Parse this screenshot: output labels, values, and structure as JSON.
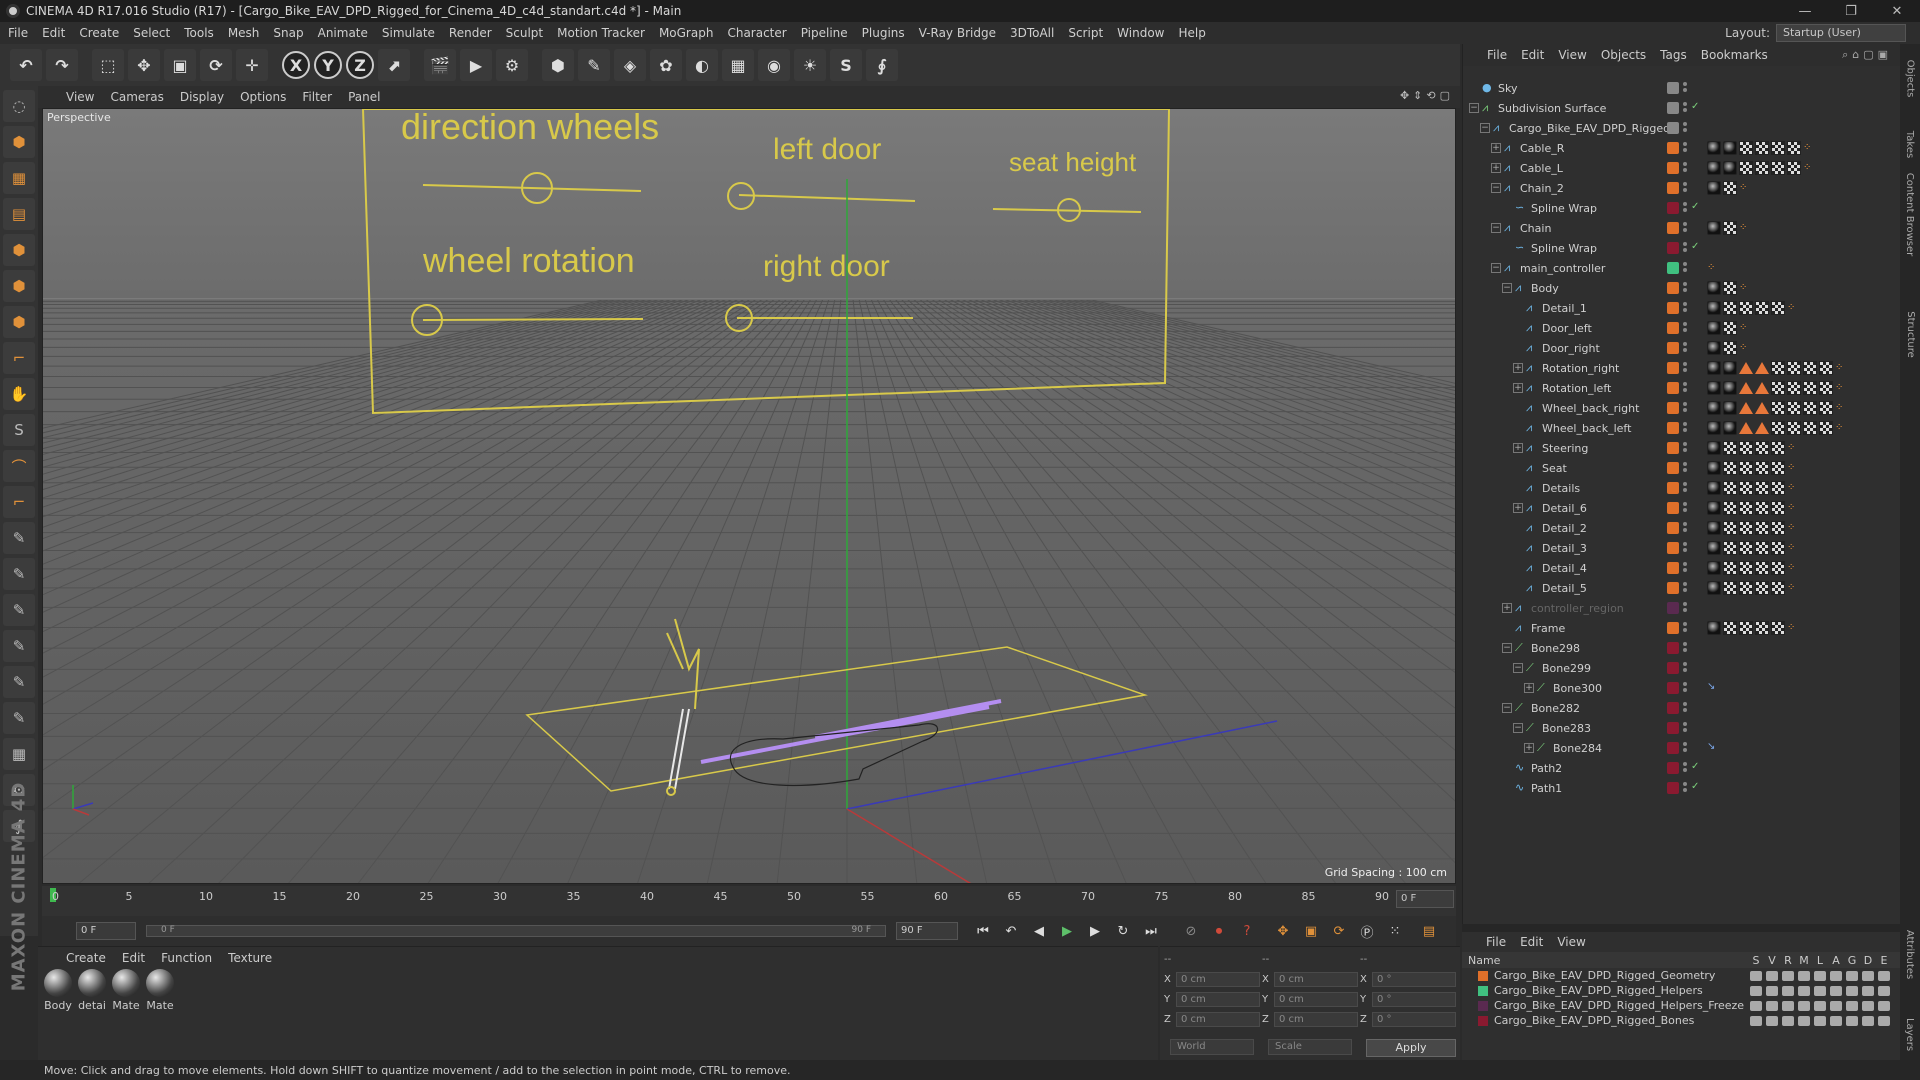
{
  "title": "CINEMA 4D R17.016 Studio (R17) - [Cargo_Bike_EAV_DPD_Rigged_for_Cinema_4D_c4d_standart.c4d *] - Main",
  "window_controls": [
    "—",
    "❐",
    "✕"
  ],
  "menu": [
    "File",
    "Edit",
    "Create",
    "Select",
    "Tools",
    "Mesh",
    "Snap",
    "Animate",
    "Simulate",
    "Render",
    "Sculpt",
    "Motion Tracker",
    "MoGraph",
    "Character",
    "Pipeline",
    "Plugins",
    "V-Ray Bridge",
    "3DToAll",
    "Script",
    "Window",
    "Help"
  ],
  "layout": {
    "label": "Layout:",
    "value": "Startup (User)"
  },
  "toolbar_icons": [
    "undo-icon",
    "redo-icon",
    "live-select-icon",
    "move-icon",
    "scale-icon",
    "rotate-icon",
    "recent-tool-icon",
    "x-axis-icon",
    "y-axis-icon",
    "z-axis-icon",
    "coordinate-system-icon",
    "render-view-icon",
    "render-picture-viewer-icon",
    "edit-render-settings-icon",
    "cube-icon",
    "pen-icon",
    "subdivision-icon",
    "array-icon",
    "deformer-icon",
    "floor-icon",
    "camera-icon",
    "light-icon",
    "sculpt-icon",
    "python-icon"
  ],
  "toolbar_axis_labels": [
    "X",
    "Y",
    "Z"
  ],
  "viewport": {
    "menu": [
      "View",
      "Cameras",
      "Display",
      "Options",
      "Filter",
      "Panel"
    ],
    "label": "Perspective",
    "grid_spacing": "Grid Spacing : 100 cm",
    "controller_labels": [
      "direction wheels",
      "left door",
      "seat height",
      "wheel rotation",
      "right door"
    ]
  },
  "timeline": {
    "ticks": [
      "0",
      "5",
      "10",
      "15",
      "20",
      "25",
      "30",
      "35",
      "40",
      "45",
      "50",
      "55",
      "60",
      "65",
      "70",
      "75",
      "80",
      "85",
      "90"
    ],
    "current_frame": "0 F"
  },
  "playback": {
    "start": "0 F",
    "slider_start": "0 F",
    "slider_end": "90 F",
    "end": "90 F"
  },
  "materials": {
    "menu": [
      "Create",
      "Edit",
      "Function",
      "Texture"
    ],
    "items": [
      "Body",
      "detai",
      "Mate",
      "Mate"
    ]
  },
  "coordinates": {
    "header": [
      "--",
      "--",
      "--"
    ],
    "rows": [
      {
        "a": "X",
        "av": "0 cm",
        "b": "X",
        "bv": "0 cm",
        "c": "X",
        "cv": "0 °"
      },
      {
        "a": "Y",
        "av": "0 cm",
        "b": "Y",
        "bv": "0 cm",
        "c": "Y",
        "cv": "0 °"
      },
      {
        "a": "Z",
        "av": "0 cm",
        "b": "Z",
        "bv": "0 cm",
        "c": "Z",
        "cv": "0 °"
      }
    ],
    "mode": "World",
    "scale": "Scale",
    "apply": "Apply"
  },
  "status": "Move: Click and drag to move elements. Hold down SHIFT to quantize movement / add to the selection in point mode, CTRL to remove.",
  "objects": {
    "menu": [
      "File",
      "Edit",
      "View",
      "Objects",
      "Tags",
      "Bookmarks"
    ],
    "rows": [
      {
        "name": "Sky",
        "depth": 0,
        "exp": "",
        "color": "#888888",
        "tags": []
      },
      {
        "name": "Subdivision Surface",
        "depth": 0,
        "exp": "−",
        "color": "#888888",
        "tags": []
      },
      {
        "name": "Cargo_Bike_EAV_DPD_Rigged",
        "depth": 1,
        "exp": "−",
        "color": "#888888",
        "tags": []
      },
      {
        "name": "Cable_R",
        "depth": 2,
        "exp": "+",
        "color": "#e0702a",
        "tags": [
          "dark",
          "dark",
          "check",
          "check",
          "check",
          "check",
          "dots"
        ]
      },
      {
        "name": "Cable_L",
        "depth": 2,
        "exp": "+",
        "color": "#e0702a",
        "tags": [
          "dark",
          "dark",
          "check",
          "check",
          "check",
          "check",
          "dots"
        ]
      },
      {
        "name": "Chain_2",
        "depth": 2,
        "exp": "−",
        "color": "#e0702a",
        "tags": [
          "dark",
          "check",
          "dots"
        ]
      },
      {
        "name": "Spline Wrap",
        "depth": 3,
        "exp": "",
        "color": "#8a1a30",
        "tags": []
      },
      {
        "name": "Chain",
        "depth": 2,
        "exp": "−",
        "color": "#e0702a",
        "tags": [
          "dark",
          "check",
          "dots"
        ]
      },
      {
        "name": "Spline Wrap",
        "depth": 3,
        "exp": "",
        "color": "#8a1a30",
        "tags": []
      },
      {
        "name": "main_controller",
        "depth": 2,
        "exp": "−",
        "color": "#40c080",
        "tags": [
          "dots"
        ]
      },
      {
        "name": "Body",
        "depth": 3,
        "exp": "−",
        "color": "#e0702a",
        "tags": [
          "dark",
          "check",
          "dots"
        ]
      },
      {
        "name": "Detail_1",
        "depth": 4,
        "exp": "",
        "color": "#e0702a",
        "tags": [
          "dark",
          "check",
          "check",
          "check",
          "check",
          "dots"
        ]
      },
      {
        "name": "Door_left",
        "depth": 4,
        "exp": "",
        "color": "#e0702a",
        "tags": [
          "dark",
          "check",
          "dots"
        ]
      },
      {
        "name": "Door_right",
        "depth": 4,
        "exp": "",
        "color": "#e0702a",
        "tags": [
          "dark",
          "check",
          "dots"
        ]
      },
      {
        "name": "Rotation_right",
        "depth": 4,
        "exp": "+",
        "color": "#e0702a",
        "tags": [
          "dark",
          "dark",
          "tri",
          "tri",
          "check",
          "check",
          "check",
          "check",
          "dots"
        ]
      },
      {
        "name": "Rotation_left",
        "depth": 4,
        "exp": "+",
        "color": "#e0702a",
        "tags": [
          "dark",
          "dark",
          "tri",
          "tri",
          "check",
          "check",
          "check",
          "check",
          "dots"
        ]
      },
      {
        "name": "Wheel_back_right",
        "depth": 4,
        "exp": "",
        "color": "#e0702a",
        "tags": [
          "dark",
          "dark",
          "tri",
          "tri",
          "check",
          "check",
          "check",
          "check",
          "dots"
        ]
      },
      {
        "name": "Wheel_back_left",
        "depth": 4,
        "exp": "",
        "color": "#e0702a",
        "tags": [
          "dark",
          "dark",
          "tri",
          "tri",
          "check",
          "check",
          "check",
          "check",
          "dots"
        ]
      },
      {
        "name": "Steering",
        "depth": 4,
        "exp": "+",
        "color": "#e0702a",
        "tags": [
          "dark",
          "check",
          "check",
          "check",
          "check",
          "dots"
        ]
      },
      {
        "name": "Seat",
        "depth": 4,
        "exp": "",
        "color": "#e0702a",
        "tags": [
          "dark",
          "check",
          "check",
          "check",
          "check",
          "dots"
        ]
      },
      {
        "name": "Details",
        "depth": 4,
        "exp": "",
        "color": "#e0702a",
        "tags": [
          "dark",
          "check",
          "check",
          "check",
          "check",
          "dots"
        ]
      },
      {
        "name": "Detail_6",
        "depth": 4,
        "exp": "+",
        "color": "#e0702a",
        "tags": [
          "dark",
          "check",
          "check",
          "check",
          "check",
          "dots"
        ]
      },
      {
        "name": "Detail_2",
        "depth": 4,
        "exp": "",
        "color": "#e0702a",
        "tags": [
          "dark",
          "check",
          "check",
          "check",
          "check",
          "dots"
        ]
      },
      {
        "name": "Detail_3",
        "depth": 4,
        "exp": "",
        "color": "#e0702a",
        "tags": [
          "dark",
          "check",
          "check",
          "check",
          "check",
          "dots"
        ]
      },
      {
        "name": "Detail_4",
        "depth": 4,
        "exp": "",
        "color": "#e0702a",
        "tags": [
          "dark",
          "check",
          "check",
          "check",
          "check",
          "dots"
        ]
      },
      {
        "name": "Detail_5",
        "depth": 4,
        "exp": "",
        "color": "#e0702a",
        "tags": [
          "dark",
          "check",
          "check",
          "check",
          "check",
          "dots"
        ]
      },
      {
        "name": "controller_region",
        "depth": 3,
        "exp": "+",
        "color": "#5a2a50",
        "tags": [],
        "dim": true
      },
      {
        "name": "Frame",
        "depth": 3,
        "exp": "",
        "color": "#e0702a",
        "tags": [
          "dark",
          "check",
          "check",
          "check",
          "check",
          "dots"
        ]
      },
      {
        "name": "Bone298",
        "depth": 3,
        "exp": "−",
        "color": "#8a1a30",
        "tags": []
      },
      {
        "name": "Bone299",
        "depth": 4,
        "exp": "−",
        "color": "#8a1a30",
        "tags": []
      },
      {
        "name": "Bone300",
        "depth": 5,
        "exp": "+",
        "color": "#8a1a30",
        "tags": [
          "blue"
        ]
      },
      {
        "name": "Bone282",
        "depth": 3,
        "exp": "−",
        "color": "#8a1a30",
        "tags": []
      },
      {
        "name": "Bone283",
        "depth": 4,
        "exp": "−",
        "color": "#8a1a30",
        "tags": []
      },
      {
        "name": "Bone284",
        "depth": 5,
        "exp": "+",
        "color": "#8a1a30",
        "tags": [
          "blue"
        ]
      },
      {
        "name": "Path2",
        "depth": 3,
        "exp": "",
        "color": "#8a1a30",
        "tags": []
      },
      {
        "name": "Path1",
        "depth": 3,
        "exp": "",
        "color": "#8a1a30",
        "tags": []
      }
    ]
  },
  "layers": {
    "menu": [
      "File",
      "Edit",
      "View"
    ],
    "header": "Name",
    "columns": [
      "S",
      "V",
      "R",
      "M",
      "L",
      "A",
      "G",
      "D",
      "E"
    ],
    "rows": [
      {
        "name": "Cargo_Bike_EAV_DPD_Rigged_Geometry",
        "color": "#e0702a"
      },
      {
        "name": "Cargo_Bike_EAV_DPD_Rigged_Helpers",
        "color": "#40c080"
      },
      {
        "name": "Cargo_Bike_EAV_DPD_Rigged_Helpers_Freeze",
        "color": "#5a2a50"
      },
      {
        "name": "Cargo_Bike_EAV_DPD_Rigged_Bones",
        "color": "#8a1a30"
      }
    ]
  },
  "right_tabs": [
    "Objects",
    "Takes",
    "Content Browser",
    "Structure",
    "Attributes",
    "Layers"
  ],
  "brand": "MAXON CINEMA 4D"
}
